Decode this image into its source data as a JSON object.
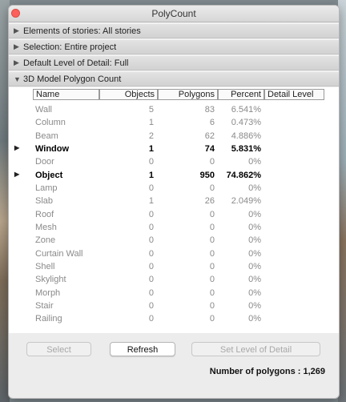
{
  "window": {
    "title": "PolyCount"
  },
  "sections": [
    {
      "label": "Elements of stories: All stories",
      "expanded": false
    },
    {
      "label": "Selection: Entire project",
      "expanded": false
    },
    {
      "label": "Default Level of Detail: Full",
      "expanded": false
    },
    {
      "label": "3D Model Polygon Count",
      "expanded": true
    }
  ],
  "table": {
    "columns": [
      "Name",
      "Objects",
      "Polygons",
      "Percent",
      "Detail Level"
    ],
    "rows": [
      {
        "name": "Wall",
        "objects": "5",
        "polygons": "83",
        "percent": "6.541%",
        "bold": false,
        "expandable": false
      },
      {
        "name": "Column",
        "objects": "1",
        "polygons": "6",
        "percent": "0.473%",
        "bold": false,
        "expandable": false
      },
      {
        "name": "Beam",
        "objects": "2",
        "polygons": "62",
        "percent": "4.886%",
        "bold": false,
        "expandable": false
      },
      {
        "name": "Window",
        "objects": "1",
        "polygons": "74",
        "percent": "5.831%",
        "bold": true,
        "expandable": true
      },
      {
        "name": "Door",
        "objects": "0",
        "polygons": "0",
        "percent": "0%",
        "bold": false,
        "expandable": false
      },
      {
        "name": "Object",
        "objects": "1",
        "polygons": "950",
        "percent": "74.862%",
        "bold": true,
        "expandable": true
      },
      {
        "name": "Lamp",
        "objects": "0",
        "polygons": "0",
        "percent": "0%",
        "bold": false,
        "expandable": false
      },
      {
        "name": "Slab",
        "objects": "1",
        "polygons": "26",
        "percent": "2.049%",
        "bold": false,
        "expandable": false
      },
      {
        "name": "Roof",
        "objects": "0",
        "polygons": "0",
        "percent": "0%",
        "bold": false,
        "expandable": false
      },
      {
        "name": "Mesh",
        "objects": "0",
        "polygons": "0",
        "percent": "0%",
        "bold": false,
        "expandable": false
      },
      {
        "name": "Zone",
        "objects": "0",
        "polygons": "0",
        "percent": "0%",
        "bold": false,
        "expandable": false
      },
      {
        "name": "Curtain Wall",
        "objects": "0",
        "polygons": "0",
        "percent": "0%",
        "bold": false,
        "expandable": false
      },
      {
        "name": "Shell",
        "objects": "0",
        "polygons": "0",
        "percent": "0%",
        "bold": false,
        "expandable": false
      },
      {
        "name": "Skylight",
        "objects": "0",
        "polygons": "0",
        "percent": "0%",
        "bold": false,
        "expandable": false
      },
      {
        "name": "Morph",
        "objects": "0",
        "polygons": "0",
        "percent": "0%",
        "bold": false,
        "expandable": false
      },
      {
        "name": "Stair",
        "objects": "0",
        "polygons": "0",
        "percent": "0%",
        "bold": false,
        "expandable": false
      },
      {
        "name": "Railing",
        "objects": "0",
        "polygons": "0",
        "percent": "0%",
        "bold": false,
        "expandable": false
      }
    ]
  },
  "buttons": {
    "select": {
      "label": "Select",
      "enabled": false
    },
    "refresh": {
      "label": "Refresh",
      "enabled": true
    },
    "set_lod": {
      "label": "Set Level of Detail",
      "enabled": false
    }
  },
  "summary": {
    "polygon_count": "Number of polygons : 1,269"
  },
  "icons": {
    "close": "close-icon",
    "collapsed": "triangle-right-icon",
    "expanded": "triangle-down-icon",
    "row_expand": "disclosure-triangle-icon"
  },
  "colors": {
    "close_button": "#fc605c",
    "section_bg": "#d9d9d9",
    "table_bg": "#ffffff",
    "muted_text": "#8a8a8a"
  }
}
